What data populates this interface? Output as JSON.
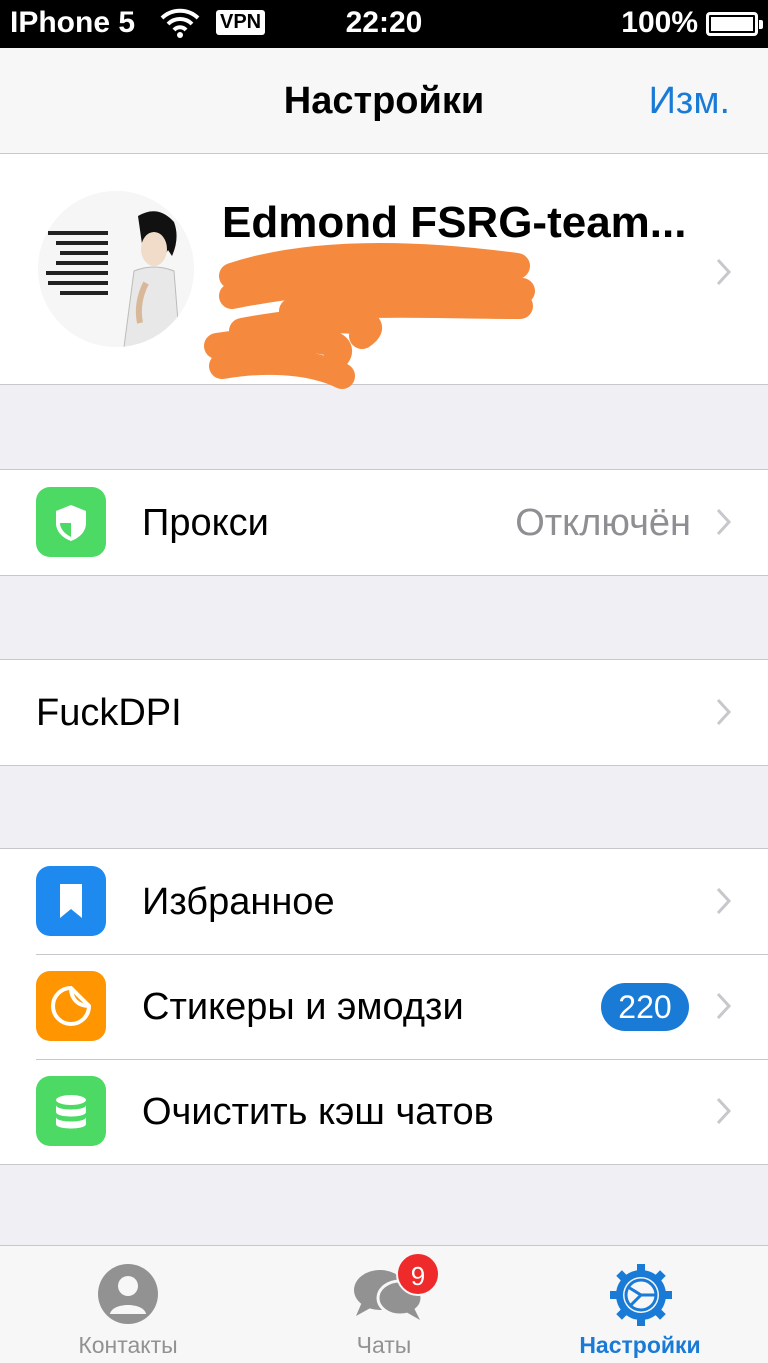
{
  "status_bar": {
    "carrier": "IPhone 5",
    "vpn": "VPN",
    "time": "22:20",
    "battery": "100%"
  },
  "nav": {
    "title": "Настройки",
    "edit": "Изм."
  },
  "profile": {
    "name": "Edmond FSRG-team..."
  },
  "proxy": {
    "label": "Прокси",
    "value": "Отключён",
    "icon": "shield-icon",
    "icon_color": "#4cd964"
  },
  "fuckdpi": {
    "label": "FuckDPI"
  },
  "favorites": {
    "label": "Избранное",
    "icon": "bookmark-icon",
    "icon_color": "#1e8af0"
  },
  "stickers": {
    "label": "Стикеры и эмодзи",
    "badge": "220",
    "icon": "sticker-icon",
    "icon_color": "#ff9500"
  },
  "cache": {
    "label": "Очистить кэш чатов",
    "icon": "database-icon",
    "icon_color": "#4cd964"
  },
  "tabs": {
    "contacts": {
      "label": "Контакты",
      "icon": "person-icon"
    },
    "chats": {
      "label": "Чаты",
      "badge": "9",
      "icon": "chat-bubbles-icon"
    },
    "settings": {
      "label": "Настройки",
      "icon": "gear-icon"
    }
  },
  "colors": {
    "accent": "#1a7bd6",
    "badge_red": "#ee2a2a",
    "background": "#efeff4"
  }
}
